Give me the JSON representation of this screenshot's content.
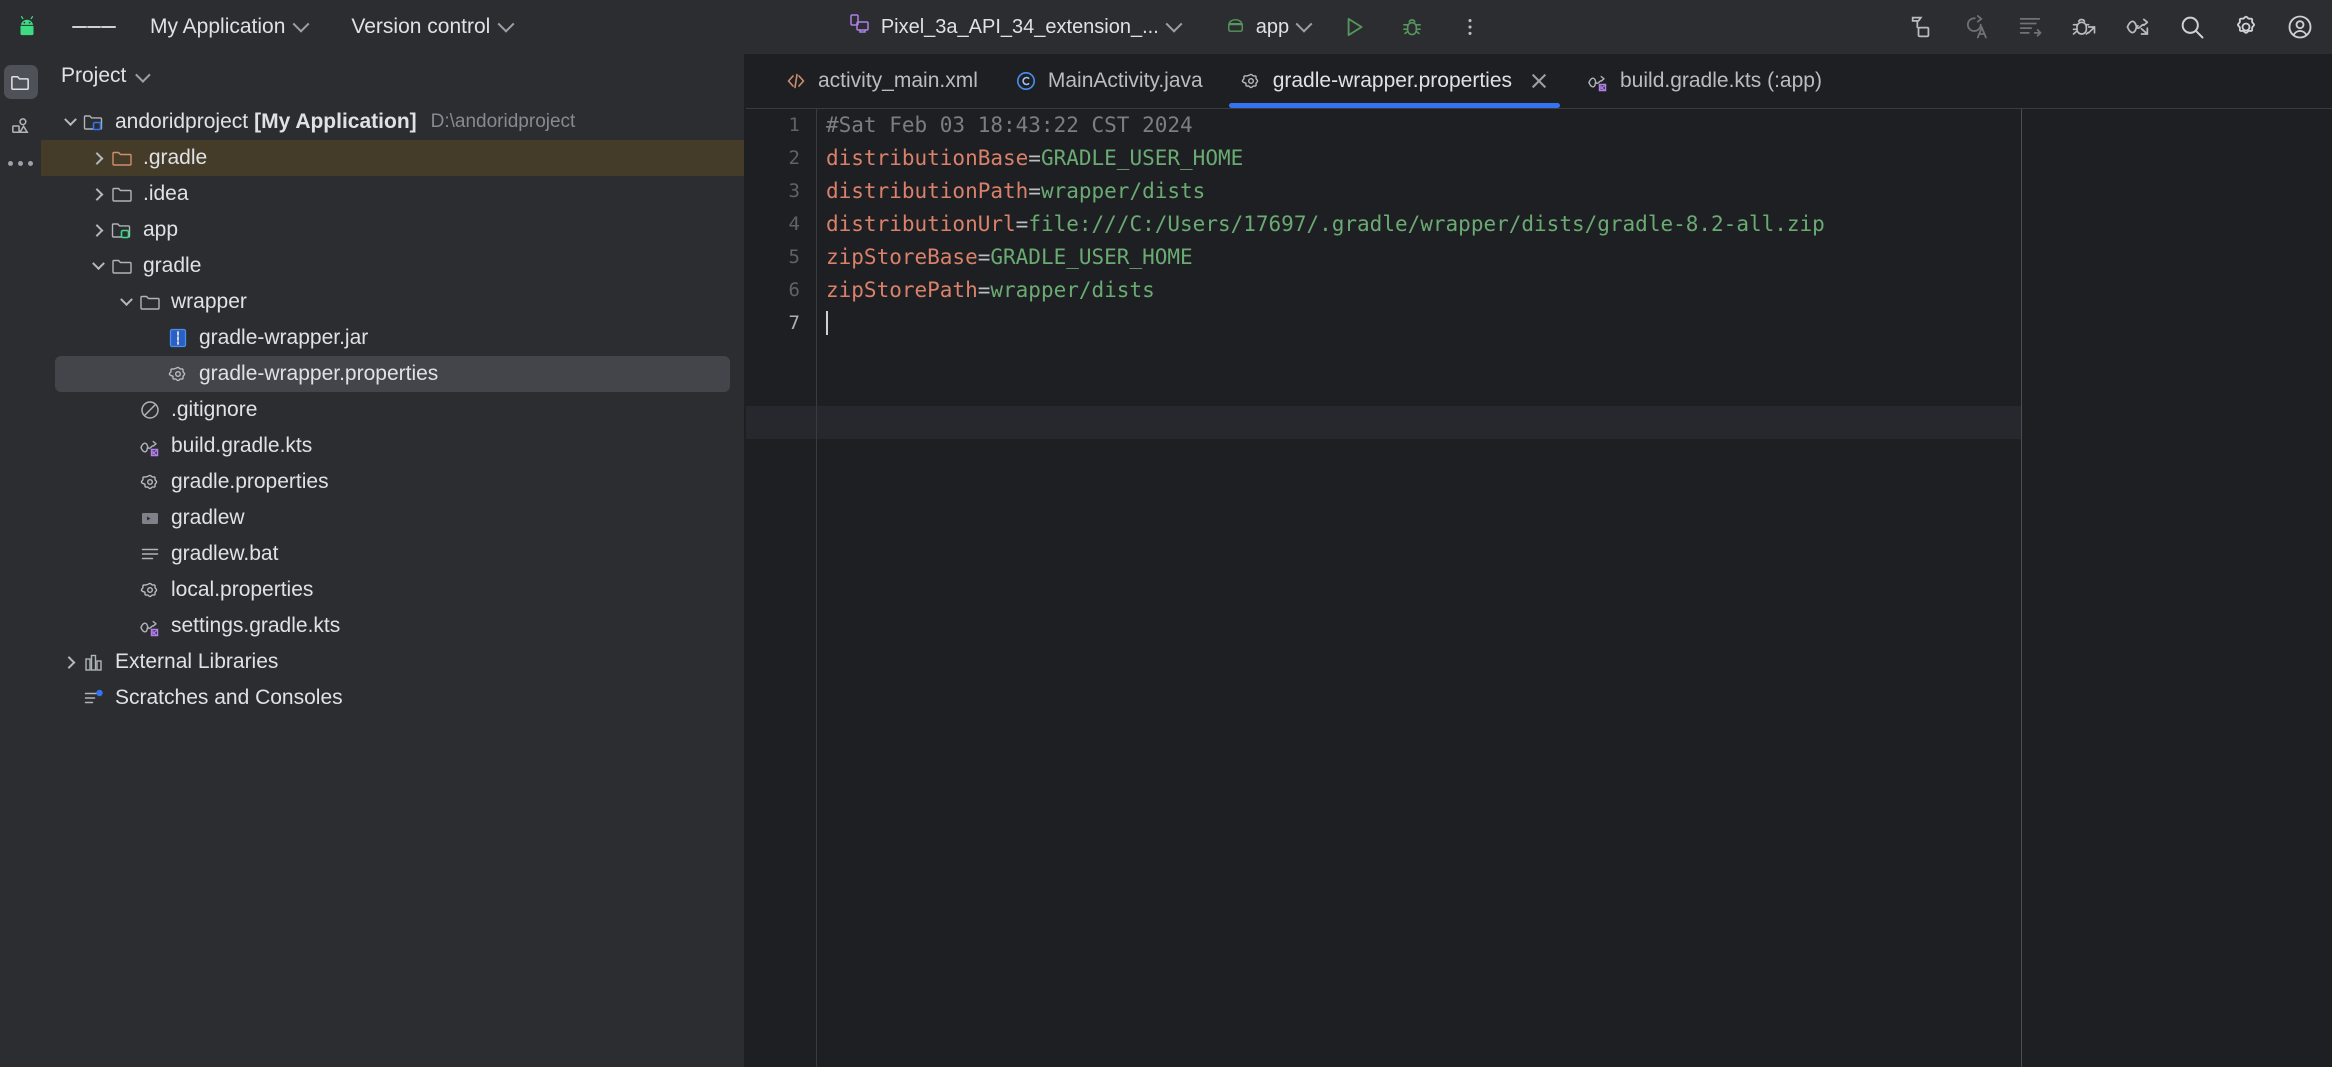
{
  "toolbar": {
    "logo_icon": "android-logo-icon",
    "menu_icon": "hamburger-menu-icon",
    "project_menu": "My Application",
    "vcs_menu": "Version control",
    "device_selector": "Pixel_3a_API_34_extension_...",
    "device_icon": "device-manager-icon",
    "run_config": "app",
    "run_config_icon": "android-config-icon",
    "run_button": "run-button",
    "debug_button": "debug-button",
    "more_button": "more-actions-button",
    "right_icons": [
      {
        "name": "build-project-icon",
        "title": "Build"
      },
      {
        "name": "code-with-me-icon",
        "title": "Code With Me"
      },
      {
        "name": "logcat-icon",
        "title": "Logcat"
      },
      {
        "name": "app-inspection-icon",
        "title": "App Inspection"
      },
      {
        "name": "profiler-icon",
        "title": "Profiler"
      },
      {
        "name": "search-everywhere-icon",
        "title": "Search"
      },
      {
        "name": "settings-gear-icon",
        "title": "Settings"
      },
      {
        "name": "account-avatar-icon",
        "title": "Account"
      }
    ]
  },
  "activitybar": {
    "items": [
      {
        "name": "project-tool-icon",
        "label": "Project",
        "active": true
      },
      {
        "name": "resource-manager-icon",
        "label": "Resource Manager",
        "active": false
      }
    ],
    "more_label": "More tool windows"
  },
  "sidebar": {
    "title": "Project",
    "chevron_icon": "chevron-down-icon",
    "tree": [
      {
        "label": "andoridproject",
        "bold_label": "[My Application]",
        "hint": "D:\\andoridproject",
        "depth": 0,
        "twisty": "expanded",
        "icon": "module-folder-icon",
        "state": "none"
      },
      {
        "label": ".gradle",
        "depth": 1,
        "twisty": "collapsed",
        "icon": "excluded-folder-icon",
        "state": "selected-inactive"
      },
      {
        "label": ".idea",
        "depth": 1,
        "twisty": "collapsed",
        "icon": "folder-icon",
        "state": "none"
      },
      {
        "label": "app",
        "depth": 1,
        "twisty": "collapsed",
        "icon": "module-green-folder-icon",
        "state": "none"
      },
      {
        "label": "gradle",
        "depth": 1,
        "twisty": "expanded",
        "icon": "folder-icon",
        "state": "none"
      },
      {
        "label": "wrapper",
        "depth": 2,
        "twisty": "expanded",
        "icon": "folder-icon",
        "state": "none"
      },
      {
        "label": "gradle-wrapper.jar",
        "depth": 3,
        "twisty": "none",
        "icon": "jar-file-icon",
        "state": "none"
      },
      {
        "label": "gradle-wrapper.properties",
        "depth": 3,
        "twisty": "none",
        "icon": "properties-file-icon",
        "state": "selected"
      },
      {
        "label": ".gitignore",
        "depth": 2,
        "twisty": "none",
        "icon": "gitignore-file-icon",
        "state": "none"
      },
      {
        "label": "build.gradle.kts",
        "depth": 2,
        "twisty": "none",
        "icon": "gradle-kts-file-icon",
        "state": "none"
      },
      {
        "label": "gradle.properties",
        "depth": 2,
        "twisty": "none",
        "icon": "properties-file-icon",
        "state": "none"
      },
      {
        "label": "gradlew",
        "depth": 2,
        "twisty": "none",
        "icon": "shell-script-file-icon",
        "state": "none"
      },
      {
        "label": "gradlew.bat",
        "depth": 2,
        "twisty": "none",
        "icon": "bat-file-icon",
        "state": "none"
      },
      {
        "label": "local.properties",
        "depth": 2,
        "twisty": "none",
        "icon": "properties-file-icon",
        "state": "none"
      },
      {
        "label": "settings.gradle.kts",
        "depth": 2,
        "twisty": "none",
        "icon": "gradle-kts-file-icon",
        "state": "none"
      },
      {
        "label": "External Libraries",
        "depth": 0,
        "twisty": "collapsed",
        "icon": "external-libraries-icon",
        "state": "none"
      },
      {
        "label": "Scratches and Consoles",
        "depth": 0,
        "twisty": "none",
        "icon": "scratches-icon",
        "state": "none"
      }
    ]
  },
  "tabs": [
    {
      "label": "activity_main.xml",
      "icon": "xml-file-icon",
      "active": false,
      "closable": false
    },
    {
      "label": "MainActivity.java",
      "icon": "java-class-icon",
      "active": false,
      "closable": false
    },
    {
      "label": "gradle-wrapper.properties",
      "icon": "properties-file-icon",
      "active": true,
      "closable": true
    },
    {
      "label": "build.gradle.kts (:app)",
      "icon": "gradle-kts-file-icon",
      "active": false,
      "closable": false
    }
  ],
  "editor": {
    "file": "gradle-wrapper.properties",
    "caret_line": 7,
    "lines": [
      {
        "n": "1",
        "type": "comment",
        "text": "#Sat Feb 03 18:43:22 CST 2024"
      },
      {
        "n": "2",
        "type": "prop",
        "key": "distributionBase",
        "value": "GRADLE_USER_HOME"
      },
      {
        "n": "3",
        "type": "prop",
        "key": "distributionPath",
        "value": "wrapper/dists"
      },
      {
        "n": "4",
        "type": "prop",
        "key": "distributionUrl",
        "value": "file:///C:/Users/17697/.gradle/wrapper/dists/gradle-8.2-all.zip"
      },
      {
        "n": "5",
        "type": "prop",
        "key": "zipStoreBase",
        "value": "GRADLE_USER_HOME"
      },
      {
        "n": "6",
        "type": "prop",
        "key": "zipStorePath",
        "value": "wrapper/dists"
      },
      {
        "n": "7",
        "type": "empty",
        "text": ""
      }
    ]
  },
  "colors": {
    "toolbar_bg": "#2b2d30",
    "editor_bg": "#1e1f22",
    "accent_blue": "#3574f0",
    "key_orange": "#d9816a",
    "value_green": "#6aab73",
    "comment_gray": "#7a7e85",
    "selection_gray": "#43454a",
    "selection_inactive": "#453b29",
    "run_green": "#57965c"
  }
}
